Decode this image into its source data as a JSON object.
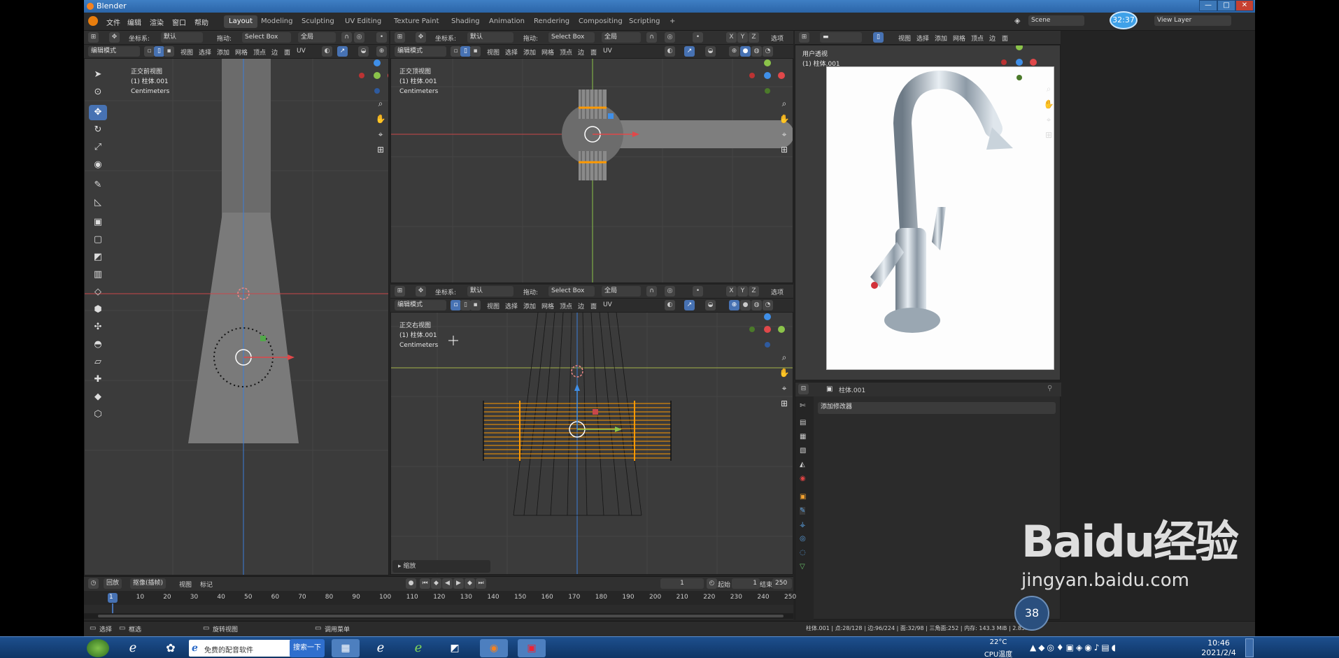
{
  "window": {
    "title": "Blender",
    "min": "—",
    "max": "□",
    "close": "✕"
  },
  "menu": [
    "文件",
    "编辑",
    "渲染",
    "窗口",
    "帮助"
  ],
  "workspaces": [
    "Layout",
    "Modeling",
    "Sculpting",
    "UV Editing",
    "Texture Paint",
    "Shading",
    "Animation",
    "Rendering",
    "Compositing",
    "Scripting"
  ],
  "workspace_add": "+",
  "scene": "Scene",
  "view_layer": "View Layer",
  "recording_time": "32:37",
  "header": {
    "coord_label": "坐标系:",
    "coord_value": "默认",
    "drag_label": "拖动:",
    "drag_value": "Select Box",
    "pivot": "全局",
    "axes": [
      "X",
      "Y",
      "Z"
    ],
    "options": "选项",
    "mode": "编辑模式",
    "view_menu": [
      "视图",
      "选择",
      "添加",
      "网格",
      "顶点",
      "边",
      "面",
      "UV"
    ]
  },
  "viewports": {
    "front": {
      "name": "正交前视图",
      "object": "(1) 柱体.001",
      "unit": "Centimeters"
    },
    "top": {
      "name": "正交顶视图",
      "object": "(1) 柱体.001",
      "unit": "Centimeters"
    },
    "right": {
      "name": "正交右视图",
      "object": "(1) 柱体.001",
      "unit": "Centimeters"
    },
    "user": {
      "name": "用户透视",
      "object": "(1) 柱体.001"
    }
  },
  "operator_panel": "缩放",
  "timeline": {
    "menus": [
      "回放",
      "抠像(插帧)",
      "视图",
      "标记"
    ],
    "current_frame": "1",
    "start_label": "起始",
    "start": "1",
    "end_label": "结束点",
    "end": "250",
    "ticks": [
      "1",
      "10",
      "20",
      "30",
      "40",
      "50",
      "60",
      "70",
      "80",
      "90",
      "100",
      "110",
      "120",
      "130",
      "140",
      "150",
      "160",
      "170",
      "180",
      "190",
      "200",
      "210",
      "220",
      "230",
      "240",
      "250"
    ]
  },
  "properties": {
    "object": "柱体.001",
    "add_modifier": "添加修改器"
  },
  "status": {
    "select": "选择",
    "box": "框选",
    "rotate": "旋转视图",
    "menu": "调用菜单",
    "stats": "柱体.001 | 点:28/128 | 边:96/224 | 面:32/98 | 三角面:252 | 内存: 143.3 MiB | 2.83.4"
  },
  "taskbar": {
    "app1": "免费的配音软件",
    "search": "搜索一下",
    "temp": "22°C",
    "cpu": "CPU温度",
    "time": "10:46",
    "date": "2021/2/4"
  },
  "watermark": {
    "brand": "Baidu经验",
    "url": "jingyan.baidu.com"
  },
  "overlay_bubble": "38",
  "colors": {
    "accent": "#4772b3",
    "selected": "#ff9900",
    "x_axis": "#e0484a",
    "y_axis": "#8bc34a",
    "z_axis": "#3f8fe8"
  }
}
